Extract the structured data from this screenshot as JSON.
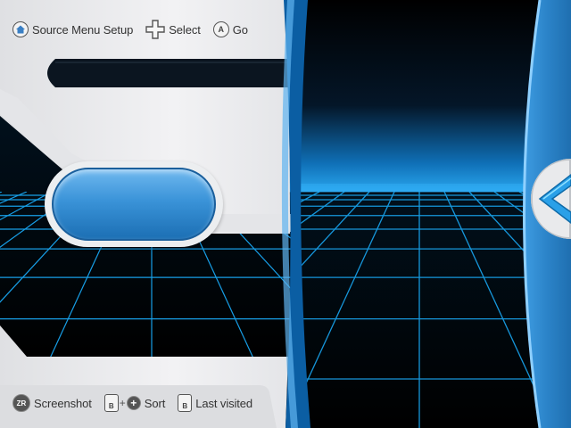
{
  "top_hints": {
    "source_menu_setup": "Source Menu Setup",
    "select": "Select",
    "go": "Go",
    "a_button": "A"
  },
  "bottom_hints": {
    "screenshot": "Screenshot",
    "sort": "Sort",
    "last_visited": "Last visited",
    "zr_button": "ZR",
    "b_button": "B"
  },
  "colors": {
    "panel": "#e8e8ea",
    "accent_blue": "#2f86cc",
    "grid_line": "#1ab0ff"
  },
  "icons": [
    "home-icon",
    "dpad-icon",
    "a-button-icon",
    "zr-button-icon",
    "b-button-icon",
    "plus-button-icon",
    "arrow-left-icon"
  ]
}
